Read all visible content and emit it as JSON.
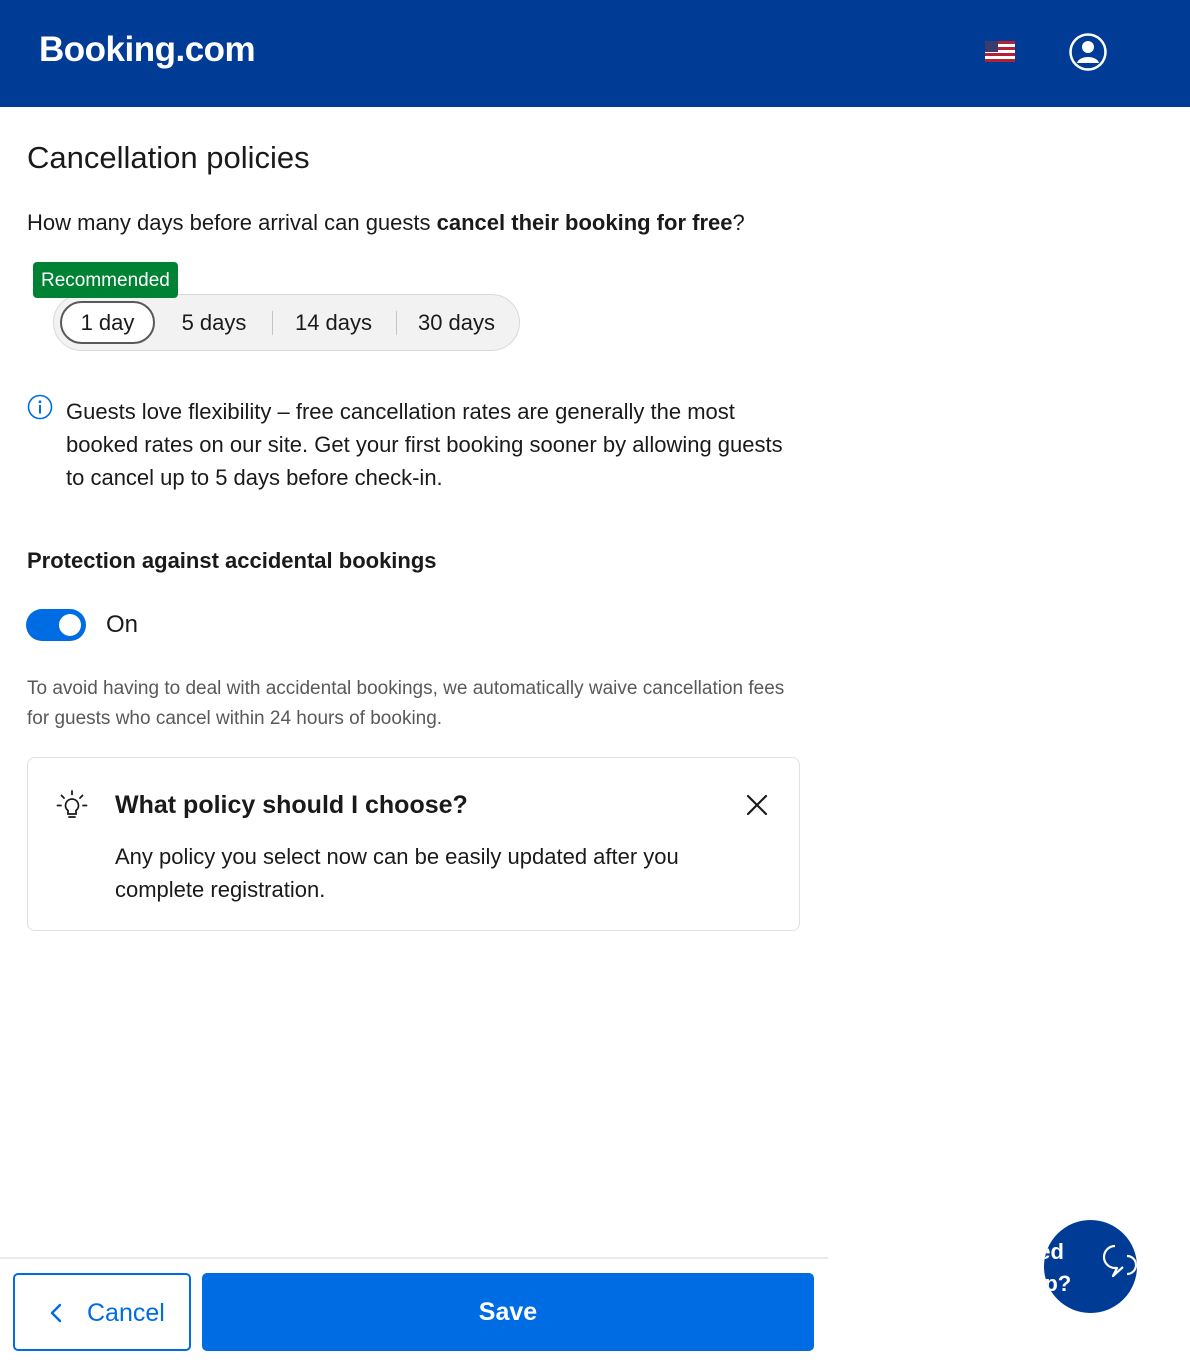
{
  "header": {
    "logo": "Booking.com",
    "flag_icon": "us-flag-icon",
    "account_icon": "user-circle-icon",
    "brand_color": "#003b95"
  },
  "page": {
    "title": "Cancellation policies",
    "question_prefix": "How many days before arrival can guests ",
    "question_bold": "cancel their booking for free",
    "question_suffix": "?"
  },
  "cancellation_options": {
    "recommended_badge": "Recommended",
    "options": [
      "1 day",
      "5 days",
      "14 days",
      "30 days"
    ],
    "selected": "1 day"
  },
  "info": {
    "icon": "info-icon",
    "text": "Guests love flexibility – free cancellation rates are generally the most booked rates on our site. Get your first booking sooner by allowing guests to cancel up to 5 days before check-in."
  },
  "protection": {
    "title": "Protection against accidental bookings",
    "toggle_state": "On",
    "description": "To avoid having to deal with accidental bookings, we automatically waive cancellation fees for guests who cancel within 24 hours of booking."
  },
  "tip": {
    "icon": "lightbulb-icon",
    "title": "What policy should I choose?",
    "body": "Any policy you select now can be easily updated after you complete registration.",
    "close_icon": "close-icon"
  },
  "footer": {
    "cancel_label": "Cancel",
    "save_label": "Save",
    "accent_color": "#006ce4"
  },
  "help": {
    "text": "eed\nelp?",
    "icon": "chat-bubble-icon"
  }
}
